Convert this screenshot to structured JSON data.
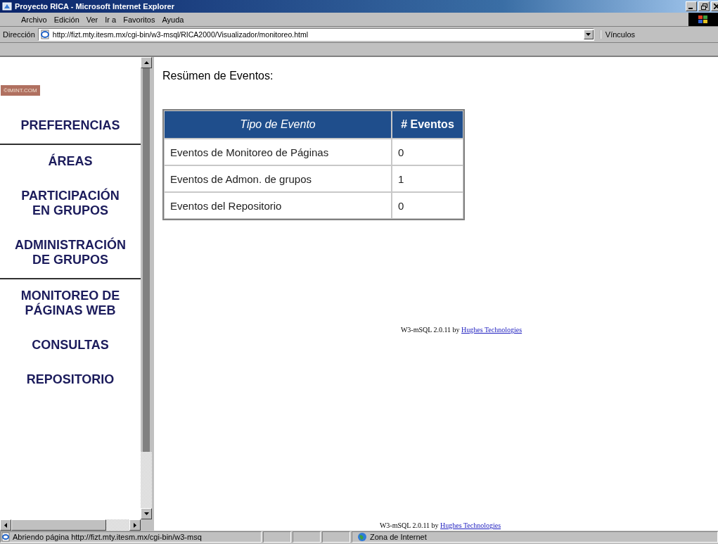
{
  "window": {
    "title": "Proyecto RICA - Microsoft Internet Explorer"
  },
  "menu": [
    "Archivo",
    "Edición",
    "Ver",
    "Ir a",
    "Favoritos",
    "Ayuda"
  ],
  "address_bar": {
    "label": "Dirección",
    "value": "http://fizt.mty.itesm.mx/cgi-bin/w3-msql/RICA2000/Visualizador/monitoreo.html",
    "links_label": "Vínculos"
  },
  "sidebar": {
    "logo_text": "©IMINT.COM",
    "items": [
      {
        "label": "PREFERENCIAS",
        "divider_after": true
      },
      {
        "label": "ÁREAS",
        "divider_after": false
      },
      {
        "label": "PARTICIPACIÓN\nEN GRUPOS",
        "divider_after": false
      },
      {
        "label": "ADMINISTRACIÓN\nDE GRUPOS",
        "divider_after": true
      },
      {
        "label": "MONITOREO DE\nPÁGINAS WEB",
        "divider_after": false
      },
      {
        "label": "CONSULTAS",
        "divider_after": false
      },
      {
        "label": "REPOSITORIO",
        "divider_after": false
      }
    ]
  },
  "main": {
    "heading": "Resümen de Eventos:",
    "table": {
      "columns": [
        "Tipo de Evento",
        "# Eventos"
      ],
      "rows": [
        [
          "Eventos de Monitoreo de Páginas",
          "0"
        ],
        [
          "Eventos de Admon. de grupos",
          "1"
        ],
        [
          "Eventos del Repositorio",
          "0"
        ]
      ]
    },
    "footer": {
      "text": "W3-mSQL 2.0.11 by",
      "link": "Hughes Technologies"
    }
  },
  "bottom_footer": {
    "text": "W3-mSQL 2.0.11 by",
    "link": "Hughes Technologies"
  },
  "status_bar": {
    "text": "Abriendo página http://fizt.mty.itesm.mx/cgi-bin/w3-msq",
    "zone": "Zona de Internet"
  }
}
